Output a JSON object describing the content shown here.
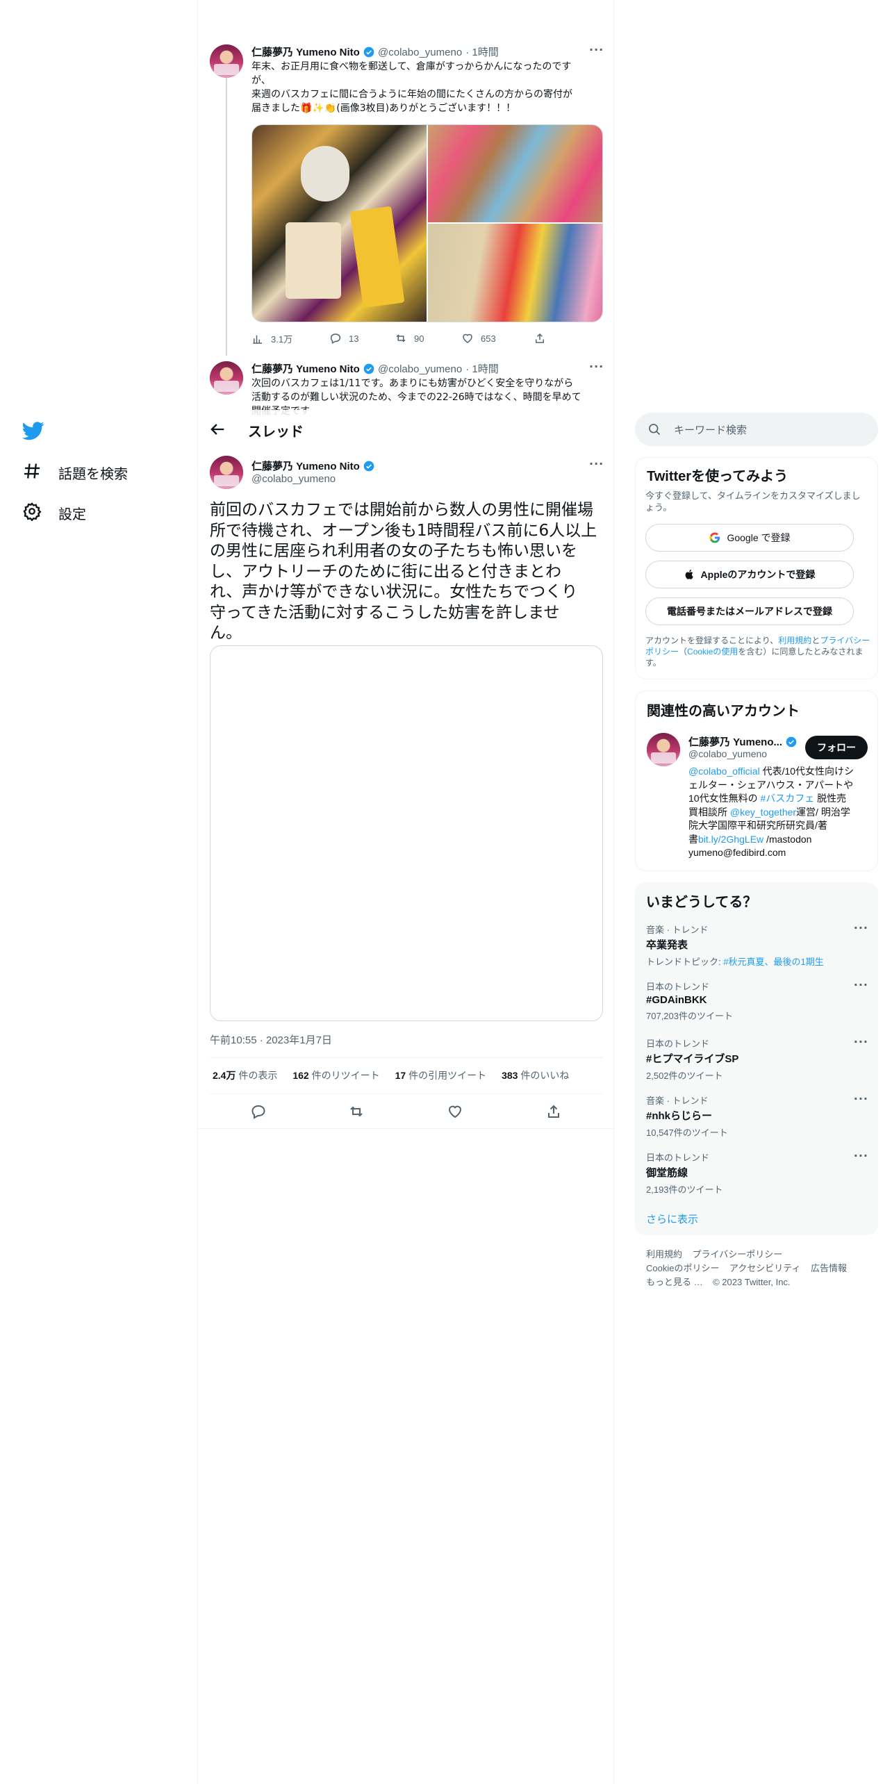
{
  "nav": {
    "explore_label": "話題を検索",
    "settings_label": "設定"
  },
  "header": {
    "title": "スレッド"
  },
  "thread_prev": [
    {
      "name": "仁藤夢乃 Yumeno Nito",
      "handle": "@colabo_yumeno",
      "time": "· 1時間",
      "text_lines": [
        "年末、お正月用に食べ物を郵送して、倉庫がすっからかんになったのです",
        "が、",
        "来週のバスカフェに間に合うように年始の間にたくさんの方からの寄付が",
        "届きました🎁✨👏(画像3枚目)ありがとうございます！！！"
      ],
      "stats": {
        "views": "3.1万",
        "replies": "13",
        "retweets": "90",
        "likes": "653"
      }
    },
    {
      "name": "仁藤夢乃 Yumeno Nito",
      "handle": "@colabo_yumeno",
      "time": "· 1時間",
      "text_lines": [
        "次回のバスカフェは1/11です。あまりにも妨害がひどく安全を守りながら",
        "活動するのが難しい状況のため、今までの22-26時ではなく、時間を早めて",
        "開催予定です"
      ]
    }
  ],
  "main_tweet": {
    "name": "仁藤夢乃 Yumeno Nito",
    "handle": "@colabo_yumeno",
    "text_lines": [
      "前回のバスカフェでは開始前から数人の男性に開催場",
      "所で待機され、オープン後も1時間程バス前に6人以上",
      "の男性に居座られ利用者の女の子たちも怖い思いを",
      "し、アウトリーチのために街に出ると付きまとわ",
      "れ、声かけ等ができない状況に。女性たちでつくり",
      "守ってきた活動に対するこうした妨害を許しませ",
      "ん。"
    ],
    "timestamp": "午前10:55 · 2023年1月7日",
    "stats": [
      {
        "value": "2.4万",
        "label": "件の表示"
      },
      {
        "value": "162",
        "label": "件のリツイート"
      },
      {
        "value": "17",
        "label": "件の引用ツイート"
      },
      {
        "value": "383",
        "label": "件のいいね"
      }
    ]
  },
  "sidebar": {
    "search_placeholder": "キーワード検索",
    "signup": {
      "title": "Twitterを使ってみよう",
      "subtitle": "今すぐ登録して、タイムラインをカスタマイズしましょう。",
      "google_button": "Google で登録",
      "apple_button": "Appleのアカウントで登録",
      "phone_button": "電話番号またはメールアドレスで登録",
      "legal_prefix": "アカウントを登録することにより、",
      "legal_terms": "利用規約",
      "legal_and": "と",
      "legal_privacy": "プライバシーポリシー",
      "legal_open": "（",
      "legal_cookie": "Cookieの使用",
      "legal_suffix": "を含む）に同意したとみなされます。"
    },
    "related": {
      "title": "関連性の高いアカウント",
      "name": "仁藤夢乃 Yumeno...",
      "handle": "@colabo_yumeno",
      "follow_label": "フォロー",
      "bio_lines": [
        {
          "parts": [
            {
              "t": "@colabo_official",
              "link": true
            },
            {
              "t": " 代表/10代女性向けシ",
              "link": false
            }
          ]
        },
        {
          "parts": [
            {
              "t": "ェルター・シェアハウス・アパートや",
              "link": false
            }
          ]
        },
        {
          "parts": [
            {
              "t": "10代女性無料の ",
              "link": false
            },
            {
              "t": "#バスカフェ",
              "link": true
            },
            {
              "t": " 脱性売",
              "link": false
            }
          ]
        },
        {
          "parts": [
            {
              "t": "買相談所 ",
              "link": false
            },
            {
              "t": "@key_together",
              "link": true
            },
            {
              "t": "運営/ 明治学",
              "link": false
            }
          ]
        },
        {
          "parts": [
            {
              "t": "院大学国際平和研究所研究員/著",
              "link": false
            }
          ]
        },
        {
          "parts": [
            {
              "t": "書",
              "link": false
            },
            {
              "t": "bit.ly/2GhgLEw",
              "link": true
            },
            {
              "t": " /mastodon",
              "link": false
            }
          ]
        },
        {
          "parts": [
            {
              "t": "yumeno@fedibird.com",
              "link": false
            }
          ]
        }
      ]
    },
    "trends": {
      "title": "いまどうしてる？",
      "items": [
        {
          "meta": "音楽 · トレンド",
          "name": "卒業発表",
          "sub_prefix": "トレンドトピック: ",
          "sub_link": "#秋元真夏、最後の1期生",
          "count": ""
        },
        {
          "meta": "日本のトレンド",
          "name": "#GDAinBKK",
          "count": "707,203件のツイート"
        },
        {
          "meta": "日本のトレンド",
          "name": "#ヒプマイライブSP",
          "count": "2,502件のツイート"
        },
        {
          "meta": "音楽 · トレンド",
          "name": "#nhkらじらー",
          "count": "10,547件のツイート"
        },
        {
          "meta": "日本のトレンド",
          "name": "御堂筋線",
          "count": "2,193件のツイート"
        }
      ],
      "show_more": "さらに表示"
    },
    "footer": {
      "line1": [
        "利用規約",
        "プライバシーポリシー"
      ],
      "line2": [
        "Cookieのポリシー",
        "アクセシビリティ",
        "広告情報"
      ],
      "more": "もっと見る …",
      "copyright": "© 2023 Twitter, Inc."
    }
  },
  "colors": {
    "accent": "#1d9bf0",
    "text": "#0f1419",
    "muted": "#536471",
    "border": "#eff3f4"
  }
}
